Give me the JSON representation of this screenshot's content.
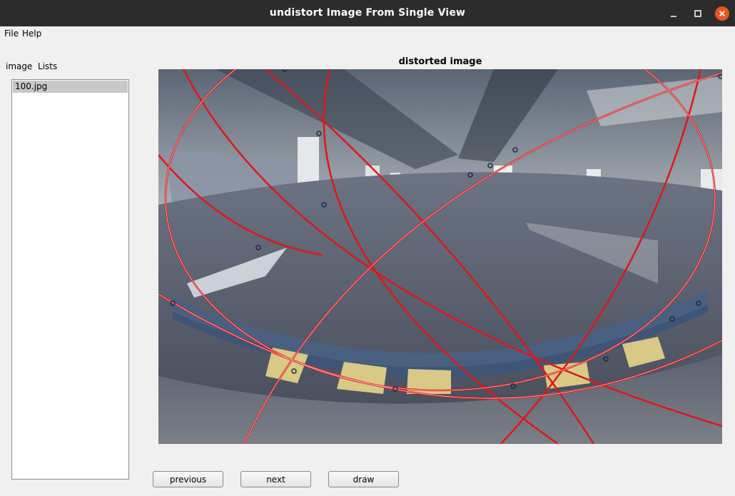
{
  "window": {
    "title": "undistort Image From Single View",
    "minimize_icon": "minimize-icon",
    "maximize_icon": "maximize-icon",
    "close_icon": "close-icon"
  },
  "menu": {
    "file": "File",
    "help": "Help"
  },
  "sidebar": {
    "label": "image  Lists",
    "items": [
      "100.jpg"
    ],
    "selected": "100.jpg"
  },
  "image_panel": {
    "title": "distorted image",
    "content": "fisheye parking garage photo with red fitted arc overlays and blue marker points"
  },
  "buttons": {
    "previous": "previous",
    "next": "next",
    "draw": "draw"
  },
  "colors": {
    "titlebar": "#2c2c2c",
    "close_button": "#e95420",
    "arc_overlay": "#e0161a",
    "selection": "#c8c8c8"
  }
}
